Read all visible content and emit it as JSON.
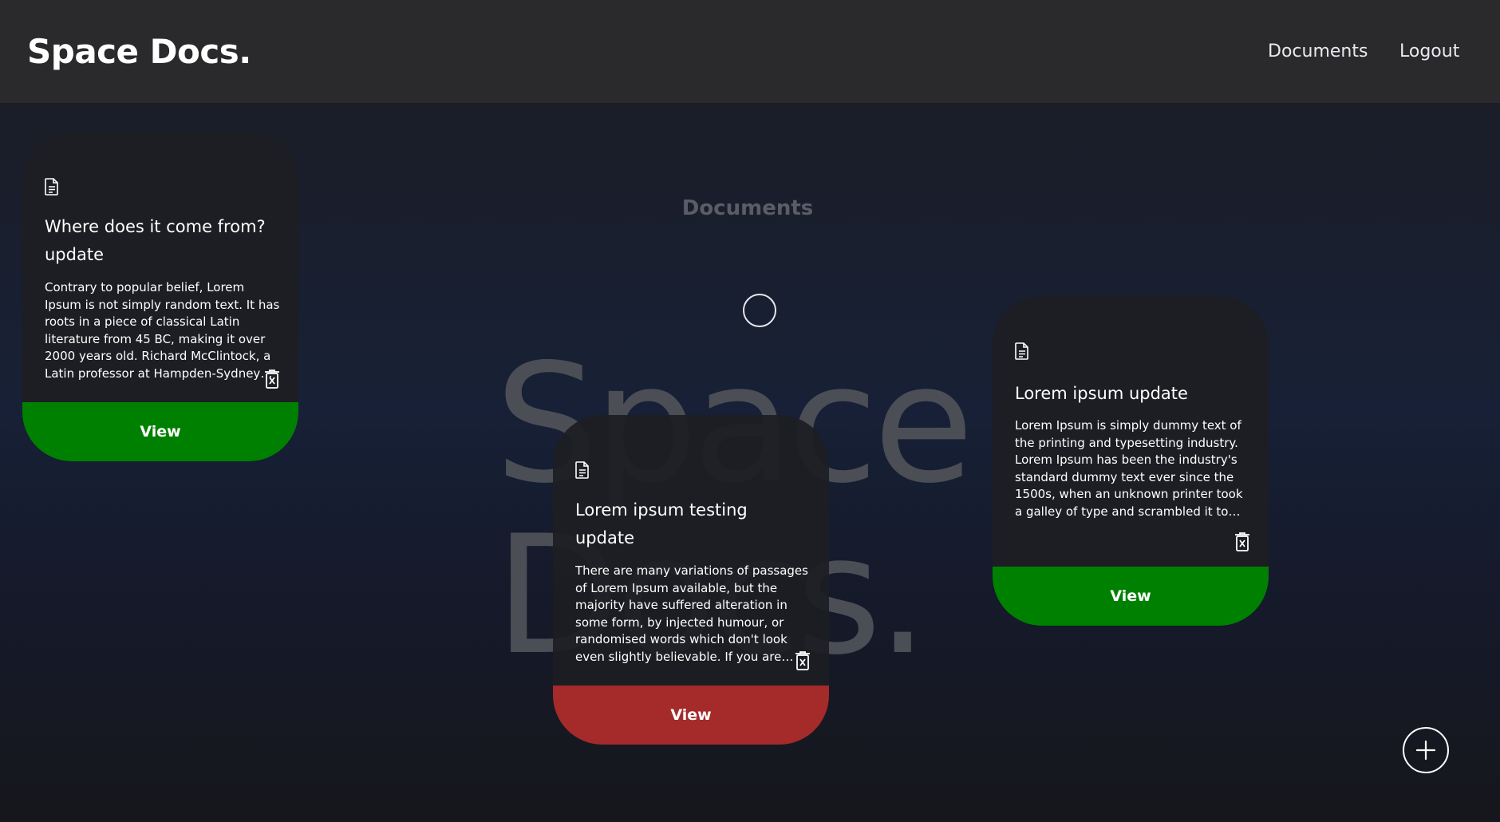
{
  "header": {
    "brand": "Space Docs.",
    "nav": {
      "documents": "Documents",
      "logout": "Logout"
    }
  },
  "main": {
    "title": "Documents",
    "watermark": "Space\nDocs."
  },
  "cards": [
    {
      "title": "Where does it come from? update",
      "body": "Contrary to popular belief, Lorem Ipsum is not simply random text. It has roots in a piece of classical Latin literature from 45 BC, making it over 2000 years old. Richard McClintock, a Latin professor at Hampden-Sydney College in Virginia, looked up one of the more obscure Latin words.",
      "view_label": "View",
      "view_color": "#008000"
    },
    {
      "title": "Lorem ipsum testing update",
      "body": "There are many variations of passages of Lorem Ipsum available, but the majority have suffered alteration in some form, by injected humour, or randomised words which don't look even slightly believable. If you are going to use a passage of Lorem Ipsum.",
      "view_label": "View",
      "view_color": "#a52a2a"
    },
    {
      "title": "Lorem ipsum update",
      "body": "Lorem Ipsum is simply dummy text of the printing and typesetting industry. Lorem Ipsum has been the industry's standard dummy text ever since the 1500s, when an unknown printer took a galley of type and scrambled it to make a type specimen book.",
      "view_label": "View",
      "view_color": "#008000"
    }
  ],
  "icons": {
    "document": "document-icon",
    "delete": "delete-icon",
    "add": "plus-icon",
    "loader": "loading-spinner"
  },
  "colors": {
    "navbar": "#2a2a2d",
    "card": "#1d1e22",
    "view_green": "#008000",
    "view_red": "#a52a2a"
  }
}
